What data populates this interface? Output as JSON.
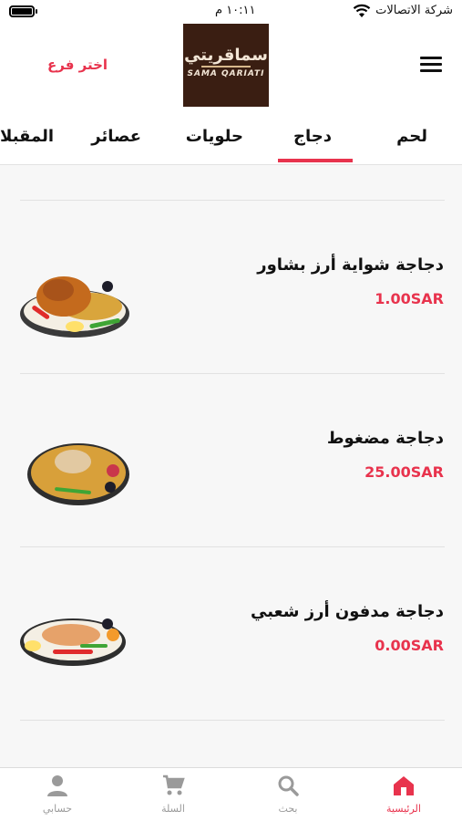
{
  "status": {
    "carrier": "شركة الاتصالات",
    "time": "١٠:١١ م"
  },
  "header": {
    "branch_label": "اختر فرع",
    "logo_text": "سماقريتي",
    "logo_subtext": "SAMA QARIATI"
  },
  "tabs": [
    {
      "label": "لحم"
    },
    {
      "label": "دجاج",
      "active": true
    },
    {
      "label": "حلويات"
    },
    {
      "label": "عصائر"
    },
    {
      "label": "المقبلات"
    }
  ],
  "items": [
    {
      "title": "دجاجة شواية أرز بشاور",
      "price": "1.00SAR"
    },
    {
      "title": "دجاجة مضغوط",
      "price": "25.00SAR"
    },
    {
      "title": "دجاجة مدفون أرز شعبي",
      "price": "0.00SAR"
    }
  ],
  "bottom_nav": [
    {
      "label": "الرئيسية",
      "icon": "home-icon",
      "active": true
    },
    {
      "label": "بحث",
      "icon": "search-icon"
    },
    {
      "label": "السلة",
      "icon": "cart-icon"
    },
    {
      "label": "حسابي",
      "icon": "account-icon"
    }
  ],
  "colors": {
    "accent": "#e8334d",
    "logo_bg": "#3a1e12"
  }
}
